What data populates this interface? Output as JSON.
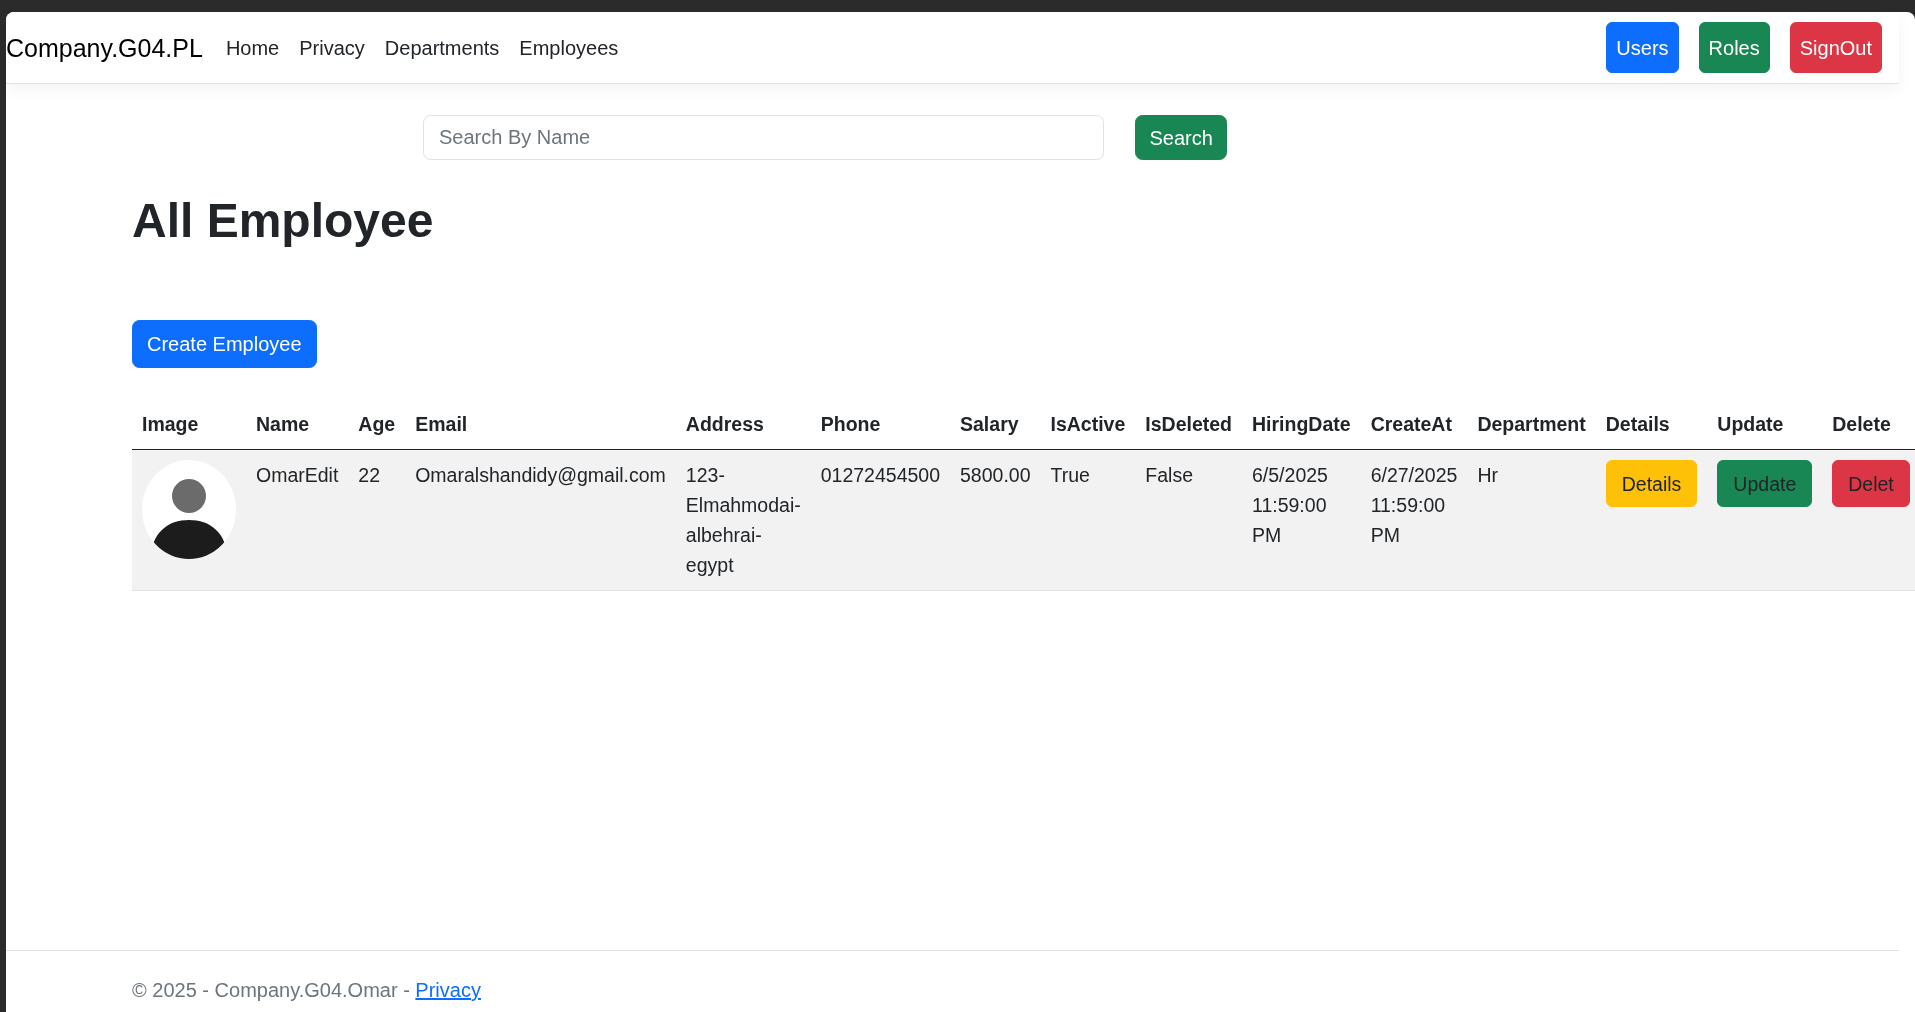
{
  "navbar": {
    "brand": "Company.G04.PL",
    "links": [
      "Home",
      "Privacy",
      "Departments",
      "Employees"
    ],
    "buttons": [
      {
        "label": "Users",
        "color": "#0d6efd"
      },
      {
        "label": "Roles",
        "color": "#198754"
      },
      {
        "label": "SignOut",
        "color": "#dc3545"
      }
    ]
  },
  "search": {
    "placeholder": "Search By Name",
    "button": "Search"
  },
  "heading": "All Employee",
  "create_button": "Create Employee",
  "table": {
    "columns": [
      "Image",
      "Name",
      "Age",
      "Email",
      "Address",
      "Phone",
      "Salary",
      "IsActive",
      "IsDeleted",
      "HiringDate",
      "CreateAt",
      "Department",
      "Details",
      "Update",
      "Delete"
    ],
    "rows": [
      {
        "cells": [
          {
            "kind": "photo"
          },
          {
            "kind": "text",
            "text": "OmarEdit"
          },
          {
            "kind": "text",
            "text": "22"
          },
          {
            "kind": "text",
            "text": "Omaralshandidy@gmail.com"
          },
          {
            "kind": "text",
            "text": "123-Elmahmodai-albehrai-egypt"
          },
          {
            "kind": "text",
            "text": "01272454500"
          },
          {
            "kind": "text",
            "text": "5800.00"
          },
          {
            "kind": "text",
            "text": "True"
          },
          {
            "kind": "text",
            "text": "False"
          },
          {
            "kind": "text",
            "text": "6/5/2025 11:59:00 PM"
          },
          {
            "kind": "text",
            "text": "6/27/2025 11:59:00 PM"
          },
          {
            "kind": "text",
            "text": "Hr"
          },
          {
            "kind": "button",
            "label": "Details",
            "color": "#ffc107"
          },
          {
            "kind": "button",
            "label": "Update",
            "color": "#198754"
          },
          {
            "kind": "button",
            "label": "Delet",
            "color": "#dc3545"
          }
        ]
      }
    ]
  },
  "footer": {
    "text": "© 2025 - Company.G04.Omar -",
    "link": "Privacy"
  }
}
